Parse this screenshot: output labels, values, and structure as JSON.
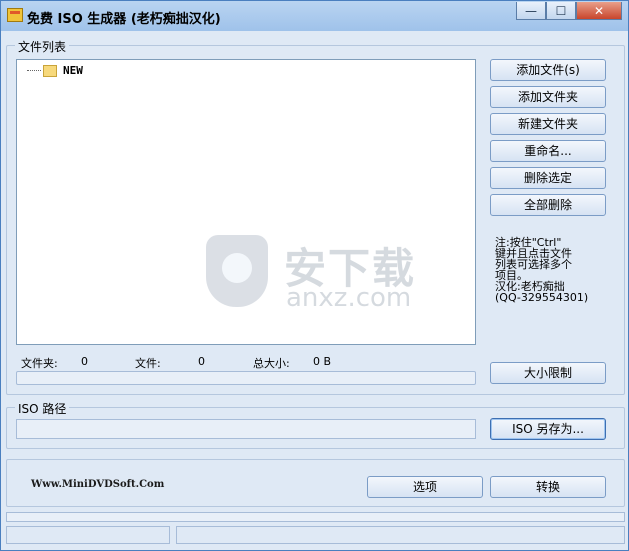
{
  "window": {
    "title": "免费 ISO 生成器 (老朽痴拙汉化)",
    "controls": {
      "minimize": "—",
      "maximize": "☐",
      "close": "✕"
    }
  },
  "file_list": {
    "group_label": "文件列表",
    "tree": [
      {
        "label": "NEW",
        "icon": "folder-icon"
      }
    ],
    "buttons": {
      "add_file": "添加文件(s)",
      "add_folder": "添加文件夹",
      "new_folder": "新建文件夹",
      "rename": "重命名...",
      "delete_selected": "删除选定",
      "delete_all": "全部删除",
      "size_limit": "大小限制"
    },
    "note_lines": [
      "注:按住\"Ctrl\"",
      "键并且点击文件",
      "列表可选择多个",
      "项目。",
      "汉化:老朽痴拙",
      "(QQ-329554301)"
    ],
    "stats": {
      "folders_label": "文件夹:",
      "folders_value": "0",
      "files_label": "文件:",
      "files_value": "0",
      "total_label": "总大小:",
      "total_value": "0 B"
    }
  },
  "iso_path": {
    "group_label": "ISO 路径",
    "save_as": "ISO 另存为..."
  },
  "footer": {
    "website": "Www.MiniDVDSoft.Com",
    "options": "选项",
    "convert": "转换"
  },
  "watermark": {
    "main": "安下载",
    "sub": "anxz.com"
  }
}
